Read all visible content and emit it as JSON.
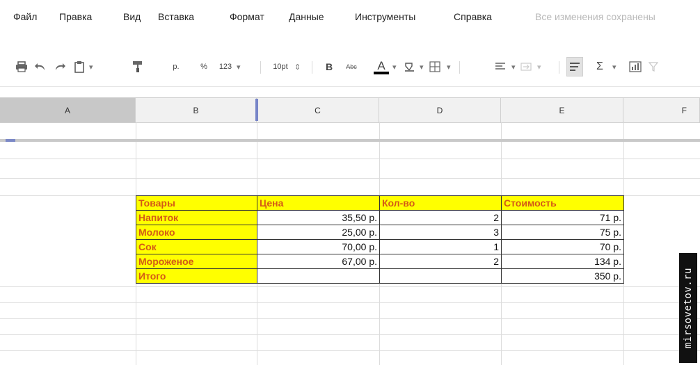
{
  "menu": {
    "items": [
      "Файл",
      "Правка",
      "Вид",
      "Вставка",
      "Формат",
      "Данные",
      "Инструменты",
      "Справка"
    ],
    "save_status": "Все изменения сохранены"
  },
  "toolbar": {
    "currency": "р.",
    "percent": "%",
    "number_format": "123",
    "font_size": "10pt",
    "bold": "B",
    "strikethrough": "Abc",
    "text_color_letter": "A",
    "text_color": "#000000",
    "sigma": "Σ"
  },
  "columns": [
    "A",
    "B",
    "C",
    "D",
    "E",
    "F"
  ],
  "table": {
    "headers": [
      "Товары",
      "Цена",
      "Кол-во",
      "Стоимость"
    ],
    "rows": [
      [
        "Напиток",
        "35,50 р.",
        "2",
        "71 р."
      ],
      [
        "Молоко",
        "25,00 р.",
        "3",
        "75 р."
      ],
      [
        "Сок",
        "70,00 р.",
        "1",
        "70 р."
      ],
      [
        "Мороженое",
        "67,00 р.",
        "2",
        "134 р."
      ],
      [
        "Итого",
        "",
        "",
        "350 р."
      ]
    ]
  },
  "colors": {
    "header_fill": "#ffff00",
    "header_text": "#d35a16",
    "selected_column": "#c8c8c8"
  },
  "watermark": "mirsovetov.ru"
}
